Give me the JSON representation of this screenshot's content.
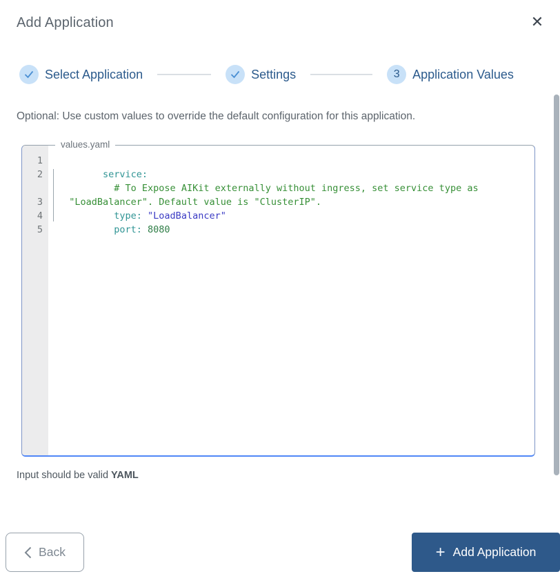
{
  "modal": {
    "title": "Add Application"
  },
  "icons": {
    "close": "✕",
    "step_check": "check-mark",
    "back_chevron": "chevron-left",
    "add_plus": "+"
  },
  "stepper": {
    "steps": [
      {
        "label": "Select Application",
        "indicator": "check",
        "state": "complete"
      },
      {
        "label": "Settings",
        "indicator": "check",
        "state": "complete"
      },
      {
        "label": "Application Values",
        "indicator": "3",
        "state": "current"
      }
    ]
  },
  "description": "Optional: Use custom values to override the default configuration for this application.",
  "editor": {
    "legend": "values.yaml",
    "lines": [
      {
        "num": "1",
        "tokens": {
          "key": "service:"
        }
      },
      {
        "num": "2",
        "tokens": {
          "comment": "# To Expose AIKit externally without ingress, set service type as \"LoadBalancer\". Default value is \"ClusterIP\"."
        }
      },
      {
        "num": "3",
        "tokens": {
          "key": "type:",
          "string": "\"LoadBalancer\""
        }
      },
      {
        "num": "4",
        "tokens": {
          "key": "port:",
          "number": "8080"
        }
      },
      {
        "num": "5",
        "tokens": {}
      }
    ]
  },
  "hint": {
    "text": "Input should be valid ",
    "bold": "YAML"
  },
  "footer": {
    "back_label": "Back",
    "add_label": "Add Application"
  },
  "colors": {
    "accent_blue": "#4f86f7",
    "primary_button": "#2e598a",
    "step_circle_bg": "#c8e1f8",
    "step_text": "#2b5a8c",
    "title_text": "#5b646d",
    "gutter_bg": "#ececed",
    "syntax_key": "#2f9494",
    "syntax_comment": "#368f36",
    "syntax_string": "#3b3bc4",
    "syntax_number": "#2e7d46"
  }
}
